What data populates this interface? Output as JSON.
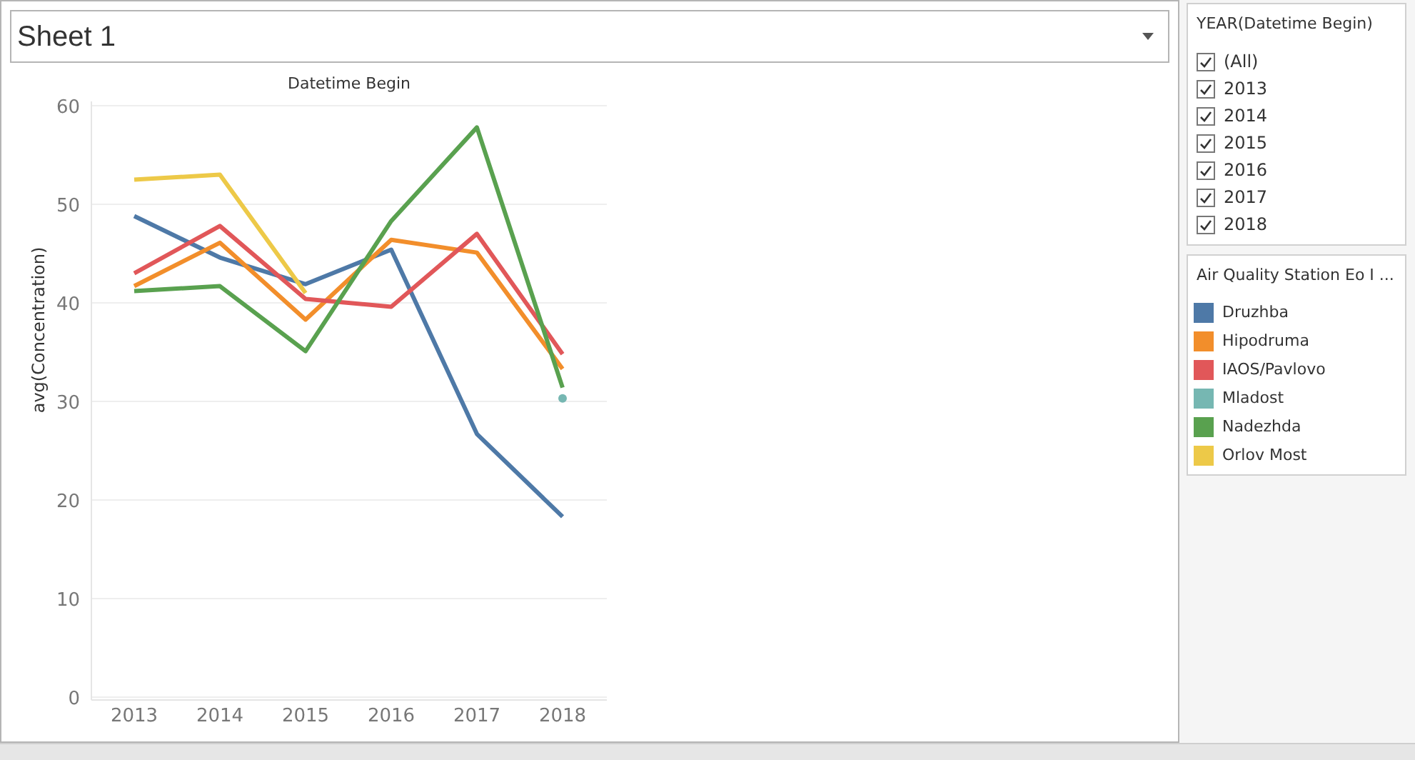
{
  "sheet_title": "Sheet 1",
  "chart_data": {
    "type": "line",
    "title": "Datetime Begin",
    "ylabel": "avg(Concentration)",
    "categories": [
      "2013",
      "2014",
      "2015",
      "2016",
      "2017",
      "2018"
    ],
    "ylim": [
      0,
      60
    ],
    "yticks": [
      0,
      10,
      20,
      30,
      40,
      50,
      60
    ],
    "grid": true,
    "series": [
      {
        "name": "Druzhba",
        "color": "#4e79a7",
        "values": [
          48.8,
          44.6,
          41.9,
          45.4,
          26.7,
          18.3
        ]
      },
      {
        "name": "Hipodruma",
        "color": "#f28e2b",
        "values": [
          41.7,
          46.1,
          38.3,
          46.4,
          45.1,
          33.3
        ]
      },
      {
        "name": "IAOS/Pavlovo",
        "color": "#e15759",
        "values": [
          43.0,
          47.8,
          40.4,
          39.6,
          47.0,
          34.8
        ]
      },
      {
        "name": "Mladost",
        "color": "#76b7b2",
        "marker": "circle",
        "values": [
          null,
          null,
          null,
          null,
          null,
          30.3
        ]
      },
      {
        "name": "Nadezhda",
        "color": "#59a14f",
        "values": [
          41.2,
          41.7,
          35.1,
          48.3,
          57.8,
          31.4
        ]
      },
      {
        "name": "Orlov Most",
        "color": "#edc948",
        "values": [
          52.5,
          53.0,
          41.0,
          null,
          null,
          null
        ]
      }
    ]
  },
  "year_filter": {
    "title": "YEAR(Datetime Begin)",
    "items": [
      {
        "label": "(All)",
        "checked": true
      },
      {
        "label": "2013",
        "checked": true
      },
      {
        "label": "2014",
        "checked": true
      },
      {
        "label": "2015",
        "checked": true
      },
      {
        "label": "2016",
        "checked": true
      },
      {
        "label": "2017",
        "checked": true
      },
      {
        "label": "2018",
        "checked": true
      }
    ]
  },
  "legend": {
    "title": "Air Quality Station Eo I ..."
  }
}
